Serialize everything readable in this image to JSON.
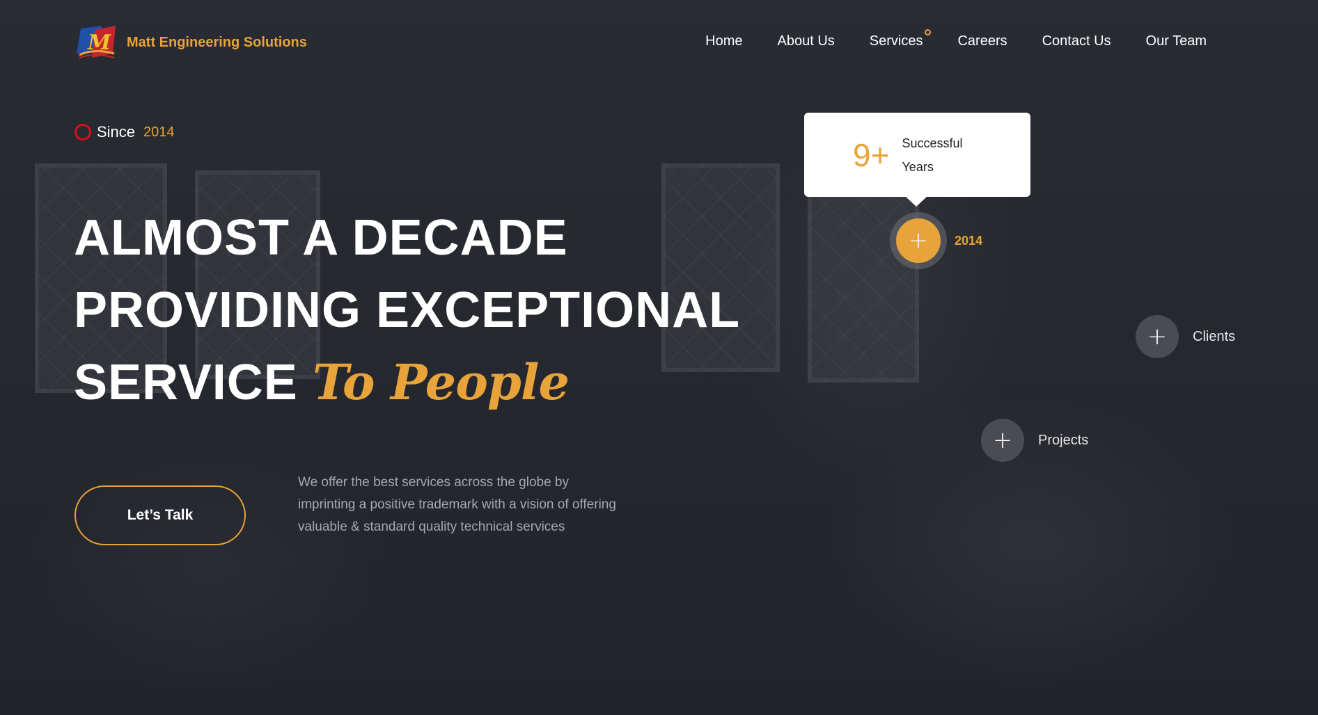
{
  "brand": {
    "name": "Matt Engineering Solutions",
    "logo_letter": "M",
    "accent_color": "#e8a33a"
  },
  "nav": {
    "items": [
      {
        "label": "Home"
      },
      {
        "label": "About Us"
      },
      {
        "label": "Services"
      },
      {
        "label": "Careers"
      },
      {
        "label": "Contact Us"
      },
      {
        "label": "Our Team"
      }
    ]
  },
  "hero": {
    "since_label": "Since",
    "since_year": "2014",
    "headline_line1": "ALMOST A DECADE",
    "headline_line2": "PROVIDING EXCEPTIONAL",
    "headline_line3": "SERVICE",
    "headline_accent": "To People",
    "cta_label": "Let’s Talk",
    "description": "We offer the best services across the globe by imprinting a positive trademark with a vision of offering valuable & standard quality technical services"
  },
  "stats_card": {
    "number": "9+",
    "text": "Successful Years"
  },
  "hotspots": [
    {
      "id": "year",
      "label": "2014",
      "active": true
    },
    {
      "id": "clients",
      "label": "Clients",
      "active": false
    },
    {
      "id": "projects",
      "label": "Projects",
      "active": false
    }
  ]
}
